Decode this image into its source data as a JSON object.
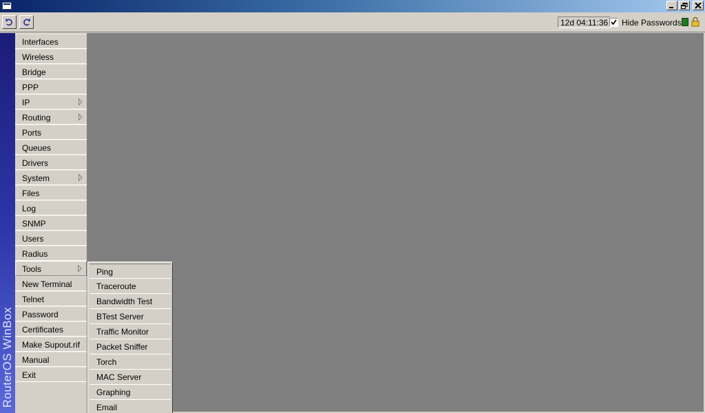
{
  "titlebar": {
    "minimize_icon": "minimize-icon",
    "restore_icon": "restore-icon",
    "close_icon": "close-icon"
  },
  "toolbar": {
    "undo_icon": "undo-icon",
    "redo_icon": "redo-icon",
    "uptime": "12d 04:11:36",
    "hide_passwords_label": "Hide Passwords",
    "hide_passwords_checked": true,
    "status_color": "#1f7a1f",
    "lock_icon": "lock-icon"
  },
  "sidebar": {
    "brand": "RouterOS WinBox",
    "items": [
      {
        "label": "Interfaces",
        "has_submenu": false
      },
      {
        "label": "Wireless",
        "has_submenu": false
      },
      {
        "label": "Bridge",
        "has_submenu": false
      },
      {
        "label": "PPP",
        "has_submenu": false
      },
      {
        "label": "IP",
        "has_submenu": true
      },
      {
        "label": "Routing",
        "has_submenu": true
      },
      {
        "label": "Ports",
        "has_submenu": false
      },
      {
        "label": "Queues",
        "has_submenu": false
      },
      {
        "label": "Drivers",
        "has_submenu": false
      },
      {
        "label": "System",
        "has_submenu": true
      },
      {
        "label": "Files",
        "has_submenu": false
      },
      {
        "label": "Log",
        "has_submenu": false
      },
      {
        "label": "SNMP",
        "has_submenu": false
      },
      {
        "label": "Users",
        "has_submenu": false
      },
      {
        "label": "Radius",
        "has_submenu": false
      },
      {
        "label": "Tools",
        "has_submenu": true,
        "selected": true
      },
      {
        "label": "New Terminal",
        "has_submenu": false
      },
      {
        "label": "Telnet",
        "has_submenu": false
      },
      {
        "label": "Password",
        "has_submenu": false
      },
      {
        "label": "Certificates",
        "has_submenu": false
      },
      {
        "label": "Make Supout.rif",
        "has_submenu": false
      },
      {
        "label": "Manual",
        "has_submenu": false
      },
      {
        "label": "Exit",
        "has_submenu": false
      }
    ]
  },
  "tools_submenu": {
    "items": [
      "Ping",
      "Traceroute",
      "Bandwidth Test",
      "BTest Server",
      "Traffic Monitor",
      "Packet Sniffer",
      "Torch",
      "MAC Server",
      "Graphing",
      "Email"
    ]
  },
  "colors": {
    "workspace": "#808080",
    "chrome": "#d4d0c8",
    "brand_strip": "#2c35a8"
  }
}
